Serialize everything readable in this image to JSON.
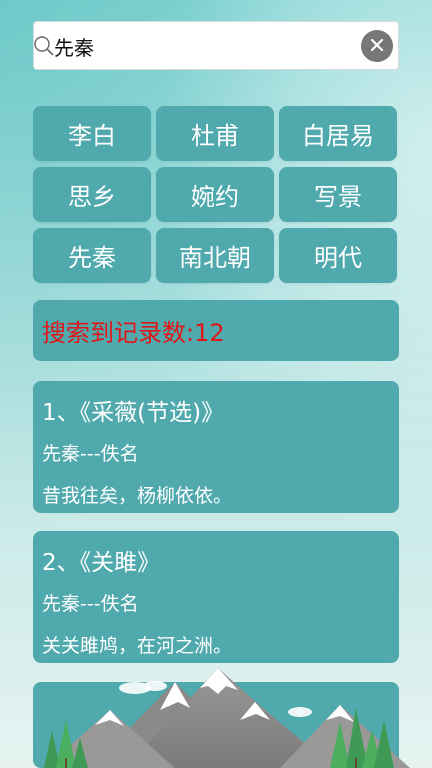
{
  "search": {
    "query": "先秦"
  },
  "tags": [
    {
      "label": "李白"
    },
    {
      "label": "杜甫"
    },
    {
      "label": "白居易"
    },
    {
      "label": "思乡"
    },
    {
      "label": "婉约"
    },
    {
      "label": "写景"
    },
    {
      "label": "先秦"
    },
    {
      "label": "南北朝"
    },
    {
      "label": "明代"
    }
  ],
  "count": {
    "text": "搜索到记录数:12"
  },
  "results": [
    {
      "title": "1、《采薇(节选)》",
      "author": "先秦---佚名",
      "line": "昔我往矣，杨柳依依。"
    },
    {
      "title": "2、《关雎》",
      "author": "先秦---佚名",
      "line": "关关雎鸠，在河之洲。"
    }
  ],
  "colors": {
    "card": "#4fa9ad",
    "count_text": "#e01717",
    "background": "#9edbd9"
  },
  "icons": {
    "search": "search-icon",
    "clear": "close-icon"
  }
}
